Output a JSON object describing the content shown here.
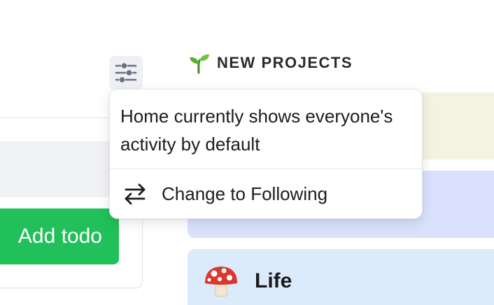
{
  "todo": {
    "add_button_label": "Add todo"
  },
  "filter": {
    "icon": "sliders-icon"
  },
  "projects": {
    "heading": "NEW PROJECTS",
    "heading_icon": "seedling-icon",
    "items": [
      {
        "name": "",
        "color": "#f4f3e1"
      },
      {
        "name": "",
        "color": "#d9e1fc"
      },
      {
        "name": "Life",
        "icon": "mushroom-icon",
        "color": "#dcebfb"
      }
    ]
  },
  "popover": {
    "message": "Home currently shows everyone's activity by default",
    "action_label": "Change to Following",
    "action_icon": "swap-arrows-icon"
  },
  "colors": {
    "accent_green": "#22c05a",
    "filter_bg": "#eef0f3"
  }
}
